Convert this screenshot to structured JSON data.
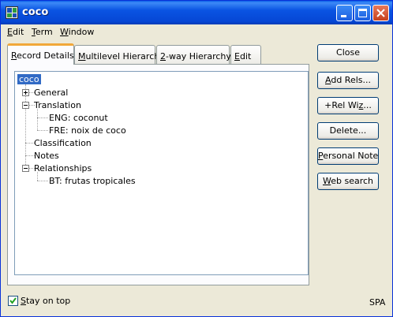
{
  "window": {
    "title": "coco"
  },
  "menu": [
    {
      "ul": "E",
      "rest": "dit"
    },
    {
      "ul": "T",
      "rest": "erm"
    },
    {
      "ul": "W",
      "rest": "indow"
    }
  ],
  "tabs": [
    {
      "ul": "R",
      "rest": "ecord Details"
    },
    {
      "ul": "M",
      "rest": "ultilevel Hierarchy"
    },
    {
      "ul": "2",
      "rest": "-way Hierarchy"
    },
    {
      "ul": "E",
      "rest": "dit"
    }
  ],
  "tree": {
    "root": "coco",
    "general": "General",
    "translation": "Translation",
    "eng": "ENG: coconut",
    "fre": "FRE: noix de coco",
    "classification": "Classification",
    "notes": "Notes",
    "relationships": "Relationships",
    "bt": "BT: frutas tropicales"
  },
  "buttons": {
    "close": "Close",
    "add_rels": {
      "ul": "A",
      "rest": "dd Rels..."
    },
    "rel_wiz": {
      "pre": "+Rel Wi",
      "ul": "z",
      "rest": "..."
    },
    "delete": "Delete...",
    "personal_note": {
      "ul": "P",
      "rest": "ersonal Note"
    },
    "web_search": {
      "ul": "W",
      "rest": "eb search"
    }
  },
  "footer": {
    "stay_on_top": {
      "ul": "S",
      "rest": "tay on top",
      "checked": true
    },
    "language": "SPA"
  }
}
